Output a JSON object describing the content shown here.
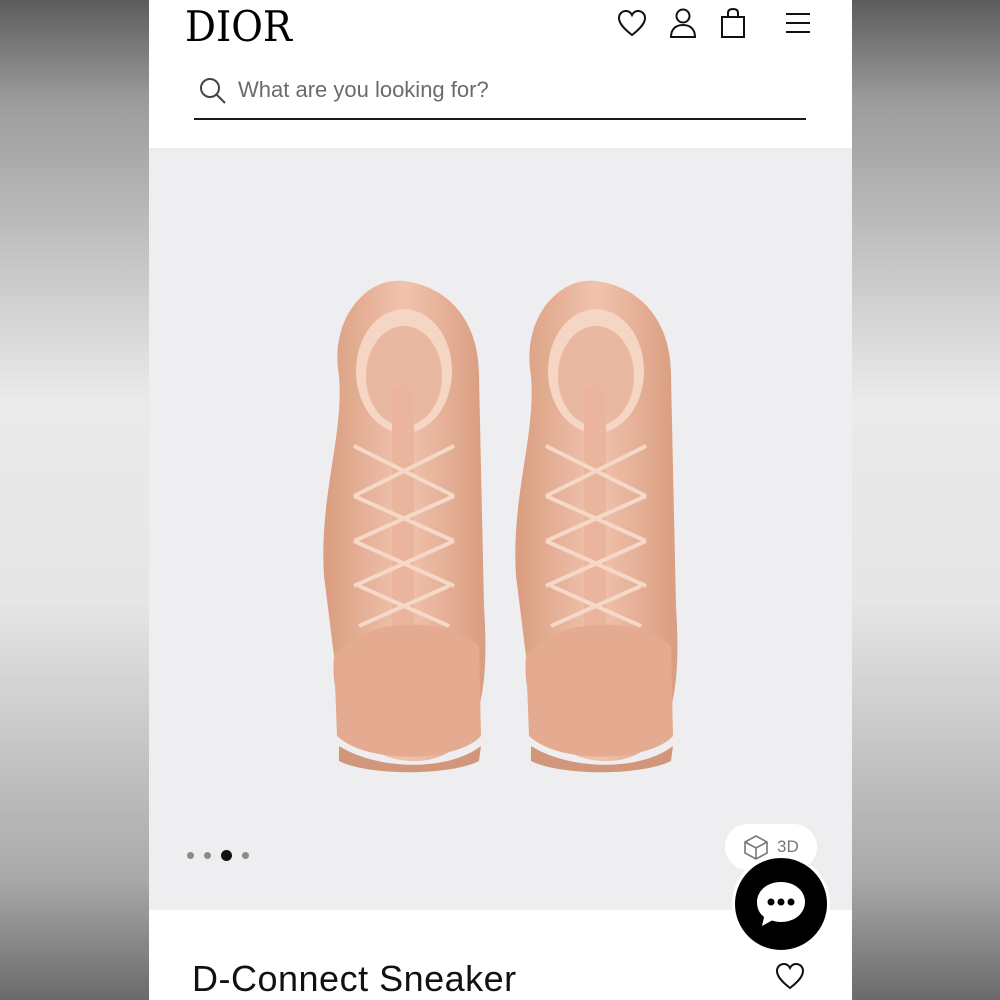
{
  "header": {
    "logo": "DIOR",
    "icons": [
      "heart-icon",
      "user-icon",
      "bag-icon",
      "menu-icon"
    ]
  },
  "search": {
    "placeholder": "What are you looking for?",
    "value": ""
  },
  "gallery": {
    "image_count": 4,
    "active_index": 2,
    "view_3d_label": "3D"
  },
  "product": {
    "name": "D-Connect Sneaker"
  },
  "colors": {
    "accent": "#000000",
    "gallery_bg": "#eeeef0",
    "shoe": "#e7b59c"
  }
}
